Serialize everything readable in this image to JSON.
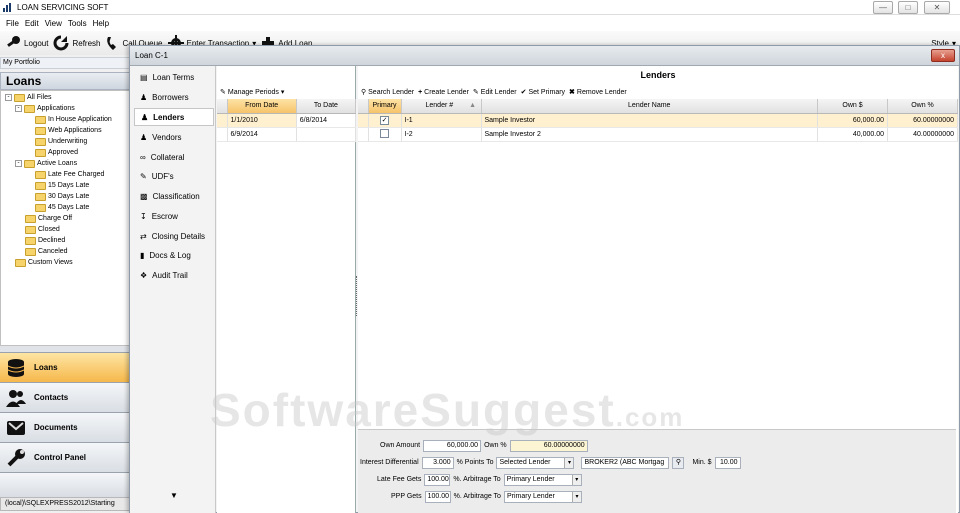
{
  "app": {
    "title": "LOAN SERVICING SOFT"
  },
  "menu": [
    "File",
    "Edit",
    "View",
    "Tools",
    "Help"
  ],
  "toolbar": {
    "logout": "Logout",
    "refresh": "Refresh",
    "call_queue": "Call Queue",
    "enter_transaction": "Enter Transaction",
    "add_loan": "Add Loan",
    "style": "Style"
  },
  "sidebar": {
    "portfolio": "My Portfolio",
    "header": "Loans",
    "tree": [
      "All Files",
      "Applications",
      "In House Application",
      "Web Applications",
      "Underwriting",
      "Approved",
      "Active Loans",
      "Late Fee Charged",
      "15 Days Late",
      "30 Days Late",
      "45 Days Late",
      "Charge Off",
      "Closed",
      "Declined",
      "Canceled",
      "Custom Views"
    ],
    "nav": {
      "loans": "Loans",
      "contacts": "Contacts",
      "documents": "Documents",
      "control_panel": "Control Panel"
    },
    "status": "(local)\\SQLEXPRESS2012\\Starting"
  },
  "loan_window": {
    "title": "Loan C-1",
    "close": "x",
    "nav": [
      "Loan Terms",
      "Borrowers",
      "Lenders",
      "Vendors",
      "Collateral",
      "UDF's",
      "Classification",
      "Escrow",
      "Closing Details",
      "Docs & Log",
      "Audit Trail"
    ],
    "periods": {
      "manage": "Manage Periods",
      "col_from": "From Date",
      "col_to": "To Date",
      "rows": [
        {
          "from": "1/1/2010",
          "to": "6/8/2014"
        },
        {
          "from": "6/9/2014",
          "to": ""
        }
      ]
    },
    "lenders": {
      "title": "Lenders",
      "actions": {
        "search": "Search Lender",
        "create": "Create Lender",
        "edit": "Edit Lender",
        "set_primary": "Set Primary",
        "remove": "Remove Lender"
      },
      "columns": {
        "primary": "Primary",
        "lender_no": "Lender #",
        "name": "Lender Name",
        "own_amt": "Own $",
        "own_pct": "Own %"
      },
      "rows": [
        {
          "primary": true,
          "lender_no": "I-1",
          "name": "Sample Investor",
          "own_amt": "60,000.00",
          "own_pct": "60.00000000"
        },
        {
          "primary": false,
          "lender_no": "I-2",
          "name": "Sample Investor 2",
          "own_amt": "40,000.00",
          "own_pct": "40.00000000"
        }
      ]
    },
    "form": {
      "own_amount_label": "Own Amount",
      "own_amount": "60,000.00",
      "own_pct_label": "Own %",
      "own_pct": "60.00000000",
      "interest_diff_label": "Interest Differential",
      "interest_diff": "3.000",
      "points_to_label": "% Points To",
      "points_to": "Selected Lender",
      "broker": "BROKER2 (ABC Mortgag",
      "min_label": "Min. $",
      "min_value": "10.00",
      "late_fee_label": "Late Fee Gets",
      "late_fee": "100.00",
      "arbitrage_label": "%. Arbitrage To",
      "late_fee_arbitrage": "Primary Lender",
      "ppp_label": "PPP Gets",
      "ppp": "100.00",
      "ppp_arbitrage": "Primary Lender"
    }
  },
  "watermark": {
    "main": "SoftwareSuggest",
    "suffix": ".com"
  }
}
